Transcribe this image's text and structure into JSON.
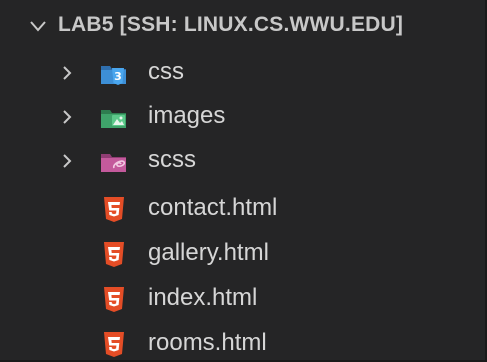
{
  "explorer": {
    "section_title": "LAB5 [SSH: LINUX.CS.WWU.EDU]",
    "folders": [
      {
        "label": "css",
        "icon": "css-folder-icon"
      },
      {
        "label": "images",
        "icon": "images-folder-icon"
      },
      {
        "label": "scss",
        "icon": "sass-folder-icon"
      }
    ],
    "files": [
      {
        "label": "contact.html",
        "icon": "html5-file-icon"
      },
      {
        "label": "gallery.html",
        "icon": "html5-file-icon"
      },
      {
        "label": "index.html",
        "icon": "html5-file-icon"
      },
      {
        "label": "rooms.html",
        "icon": "html5-file-icon"
      }
    ]
  },
  "colors": {
    "background": "#252526",
    "text": "#d6d6d6",
    "css_folder": "#3d8fd6",
    "images_folder": "#3fa36a",
    "sass_folder": "#c45a9c",
    "html5": "#e44d26"
  }
}
